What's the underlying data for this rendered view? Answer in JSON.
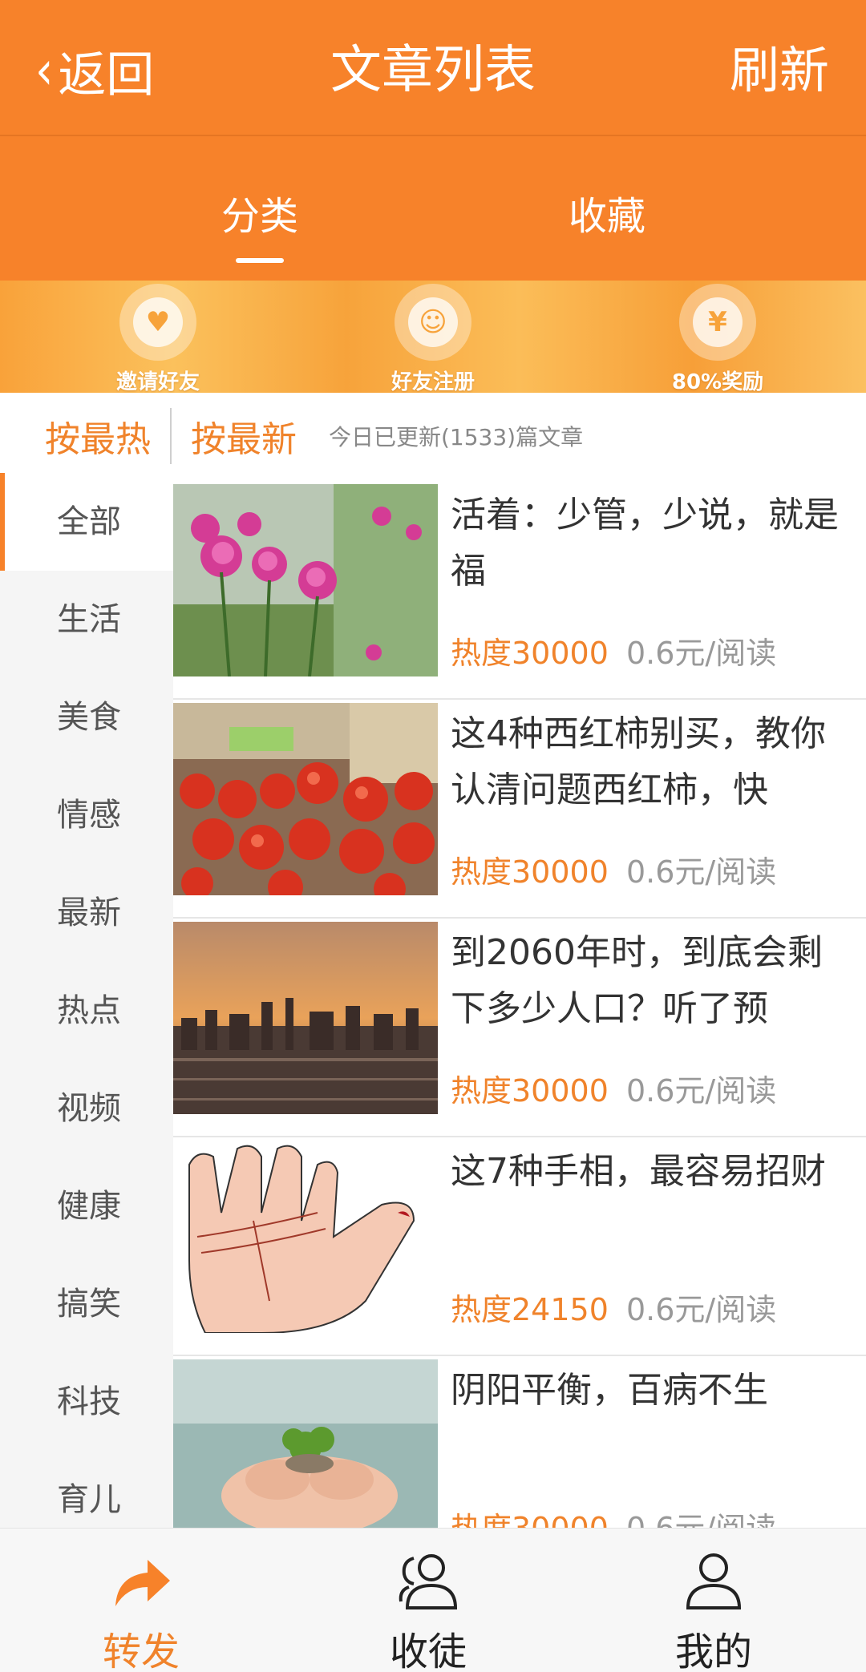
{
  "header": {
    "back_label": "返回",
    "title": "文章列表",
    "refresh_label": "刷新"
  },
  "tabs": [
    {
      "label": "分类",
      "active": true
    },
    {
      "label": "收藏",
      "active": false
    }
  ],
  "promo": [
    {
      "label": "邀请好友",
      "icon": "heart-envelope-icon"
    },
    {
      "label": "好友注册",
      "icon": "id-card-icon"
    },
    {
      "label": "80%奖励",
      "icon": "money-bag-icon"
    }
  ],
  "sort": {
    "hot_label": "按最热",
    "new_label": "按最新",
    "update_info": "今日已更新(1533)篇文章"
  },
  "categories": [
    "全部",
    "生活",
    "美食",
    "情感",
    "最新",
    "热点",
    "视频",
    "健康",
    "搞笑",
    "科技",
    "育儿"
  ],
  "articles": [
    {
      "title": "活着：少管，少说，就是福",
      "heat": "热度30000",
      "price": "0.6元/阅读",
      "image": "peony-flowers"
    },
    {
      "title": "这4种西红柿别买，教你认清问题西红柿，快",
      "heat": "热度30000",
      "price": "0.6元/阅读",
      "image": "tomatoes"
    },
    {
      "title": "到2060年时，到底会剩下多少人口？听了预",
      "heat": "热度30000",
      "price": "0.6元/阅读",
      "image": "city-skyline"
    },
    {
      "title": "这7种手相，最容易招财",
      "heat": "热度24150",
      "price": "0.6元/阅读",
      "image": "palm-lines"
    },
    {
      "title": "阴阳平衡，百病不生",
      "heat": "热度30000",
      "price": "0.6元/阅读",
      "image": "hands-with-plant"
    }
  ],
  "bottom_nav": [
    {
      "label": "转发",
      "icon": "share-arrow-icon",
      "active": true
    },
    {
      "label": "收徒",
      "icon": "users-icon",
      "active": false
    },
    {
      "label": "我的",
      "icon": "user-icon",
      "active": false
    }
  ],
  "colors": {
    "brand": "#f7822a",
    "accent_text": "#f0832b"
  }
}
